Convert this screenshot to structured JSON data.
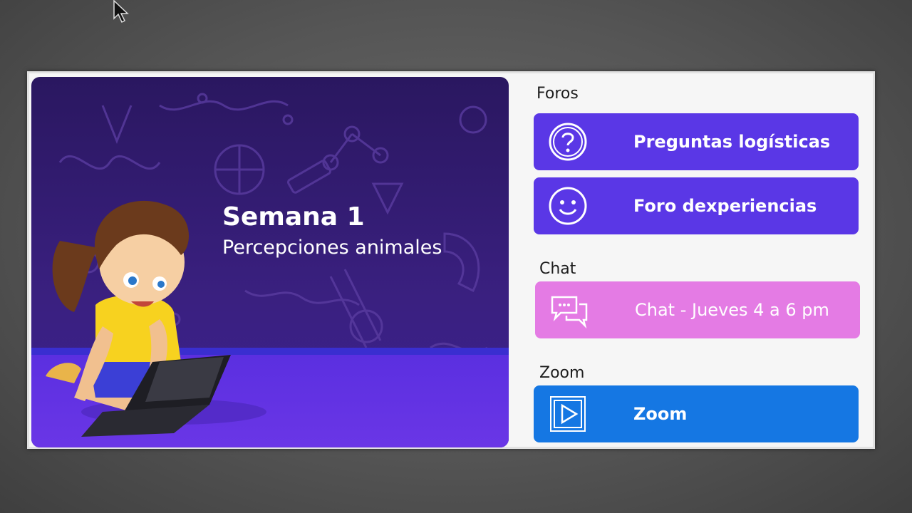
{
  "banner": {
    "title": "Semana 1",
    "subtitle": "Percepciones animales"
  },
  "sections": {
    "foros": "Foros",
    "chat": "Chat",
    "zoom": "Zoom"
  },
  "buttons": {
    "preguntas": {
      "label": "Preguntas logísticas",
      "icon": "question-circle-icon",
      "color": "#5a37e6"
    },
    "experiencias": {
      "label": "Foro dexperiencias",
      "icon": "smiley-icon",
      "color": "#5a37e6"
    },
    "chat": {
      "label": "Chat - Jueves 4 a 6 pm",
      "icon": "chat-bubbles-icon",
      "color": "#e47be4"
    },
    "zoom": {
      "label": "Zoom",
      "icon": "play-video-icon",
      "color": "#1577e3"
    }
  }
}
